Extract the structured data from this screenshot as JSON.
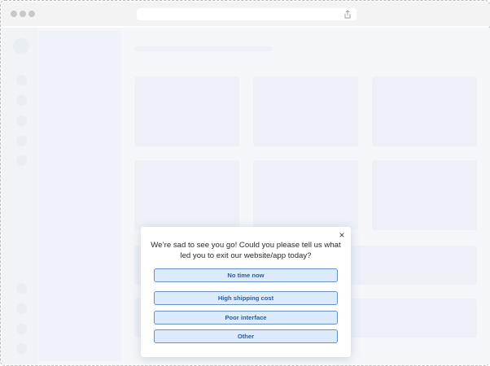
{
  "browser": {
    "window_controls": [
      "close-dot",
      "minimize-dot",
      "maximize-dot"
    ],
    "address_icon": "share-icon"
  },
  "modal": {
    "close_label": "×",
    "question": "We’re sad to see you go! Could you please tell us what led you to exit our website/app today?",
    "options": [
      {
        "label": "No time now"
      },
      {
        "label": "High shipping cost"
      },
      {
        "label": "Poor interface"
      },
      {
        "label": "Other"
      }
    ]
  },
  "colors": {
    "option_fill": "#dcebfb",
    "option_border": "#6a8fc2",
    "option_text": "#2e5b9d",
    "page_background": "#eef2f8"
  }
}
